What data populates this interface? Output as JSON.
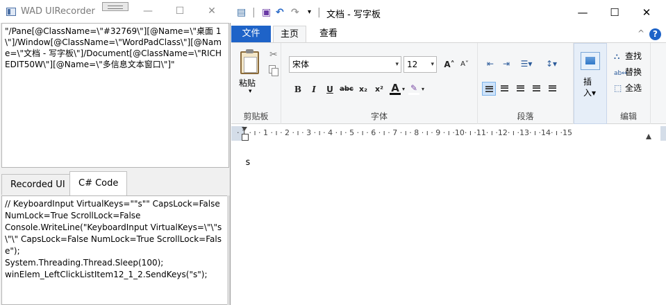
{
  "recorder": {
    "title": "WAD UIRecorder",
    "minimize_glyph": "—",
    "maximize_glyph": "☐",
    "close_glyph": "✕",
    "xpath_text": "\"/Pane[@ClassName=\\\"#32769\\\"][@Name=\\\"桌面 1\\\"]/Window[@ClassName=\\\"WordPadClass\\\"][@Name=\\\"文档 - 写字板\\\"]/Document[@ClassName=\\\"RICHEDIT50W\\\"][@Name=\\\"多信息文本窗口\\\"]\"",
    "tabs": [
      "Recorded UI",
      "C# Code"
    ],
    "active_tab": "C# Code",
    "code_text": "// KeyboardInput VirtualKeys=\"\"s\"\" CapsLock=False NumLock=True ScrollLock=False\nConsole.WriteLine(\"KeyboardInput VirtualKeys=\\\"\\\"s\\\"\\\" CapsLock=False NumLock=True ScrollLock=False\");\nSystem.Threading.Thread.Sleep(100);\nwinElem_LeftClickListItem12_1_2.SendKeys(\"s\");"
  },
  "wordpad": {
    "title": "文档 - 写字板",
    "qa_separator": "|",
    "qa_dropdown": "▾",
    "minimize_glyph": "—",
    "maximize_glyph": "☐",
    "close_glyph": "✕",
    "tabs": {
      "file": "文件",
      "home": "主页",
      "view": "查看"
    },
    "collapse_glyph": "^",
    "help_glyph": "?",
    "clipboard": {
      "paste": "粘贴",
      "paste_arrow": "▾",
      "group": "剪贴板"
    },
    "font": {
      "name": "宋体",
      "size": "12",
      "dropdown_glyph": "▾",
      "grow": "A˄",
      "shrink": "A˅",
      "bold": "B",
      "italic": "I",
      "underline": "U",
      "strike": "abc",
      "subscript": "x₂",
      "superscript": "x²",
      "color": "A",
      "highlight": "✎",
      "group": "字体"
    },
    "paragraph": {
      "outdent": "⇤",
      "indent": "⇥",
      "list": "☰▾",
      "spacing": "↕▾",
      "group": "段落"
    },
    "insert": {
      "label": "插\n入▾"
    },
    "editing": {
      "find": "查找",
      "replace": "替换",
      "select_all": "全选",
      "group": "编辑"
    },
    "ruler_text": "· 1 · ı · 1 · ı · 2 · ı · 3 · ı · 4 · ı · 5 · ı · 6 · ı · 7 · ı · 8 · ı · 9 · ı ·10· ı ·11· ı ·12· ı ·13· ı ·14· ı ·15",
    "document_text": "s",
    "accent": "#1e63c8"
  }
}
